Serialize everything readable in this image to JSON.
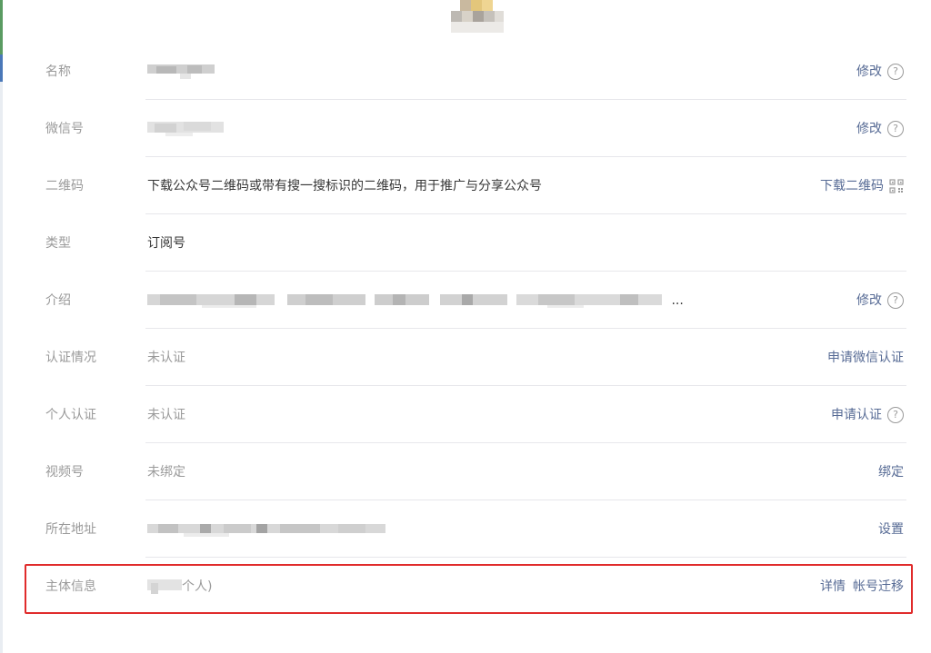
{
  "account_info": {
    "rows": [
      {
        "key": "name",
        "label": "名称",
        "value": "",
        "actions": [
          "修改"
        ],
        "help": true
      },
      {
        "key": "wechat_id",
        "label": "微信号",
        "value": "",
        "actions": [
          "修改"
        ],
        "help": true
      },
      {
        "key": "qrcode",
        "label": "二维码",
        "value": "下载公众号二维码或带有搜一搜标识的二维码，用于推广与分享公众号",
        "actions": [
          "下载二维码"
        ],
        "qr_icon": true
      },
      {
        "key": "type",
        "label": "类型",
        "value": "订阅号",
        "actions": []
      },
      {
        "key": "intro",
        "label": "介绍",
        "value": "...",
        "actions": [
          "修改"
        ],
        "help": true
      },
      {
        "key": "verification",
        "label": "认证情况",
        "value": "未认证",
        "actions": [
          "申请微信认证"
        ]
      },
      {
        "key": "personal_verification",
        "label": "个人认证",
        "value": "未认证",
        "actions": [
          "申请认证"
        ],
        "help": true
      },
      {
        "key": "channels",
        "label": "视频号",
        "value": "未绑定",
        "actions": [
          "绑定"
        ]
      },
      {
        "key": "address",
        "label": "所在地址",
        "value": "",
        "actions": [
          "设置"
        ]
      },
      {
        "key": "entity",
        "label": "主体信息",
        "value": "个人)",
        "actions": [
          "详情",
          "帐号迁移"
        ]
      }
    ],
    "help_glyph": "?"
  },
  "colors": {
    "link": "#576b95",
    "label": "#9a9a9a",
    "text": "#353535",
    "divider": "#e7e7eb",
    "highlight_border": "#e02b2b"
  },
  "icons": {
    "help": "question-circle-icon",
    "qr": "qr-code-icon"
  }
}
